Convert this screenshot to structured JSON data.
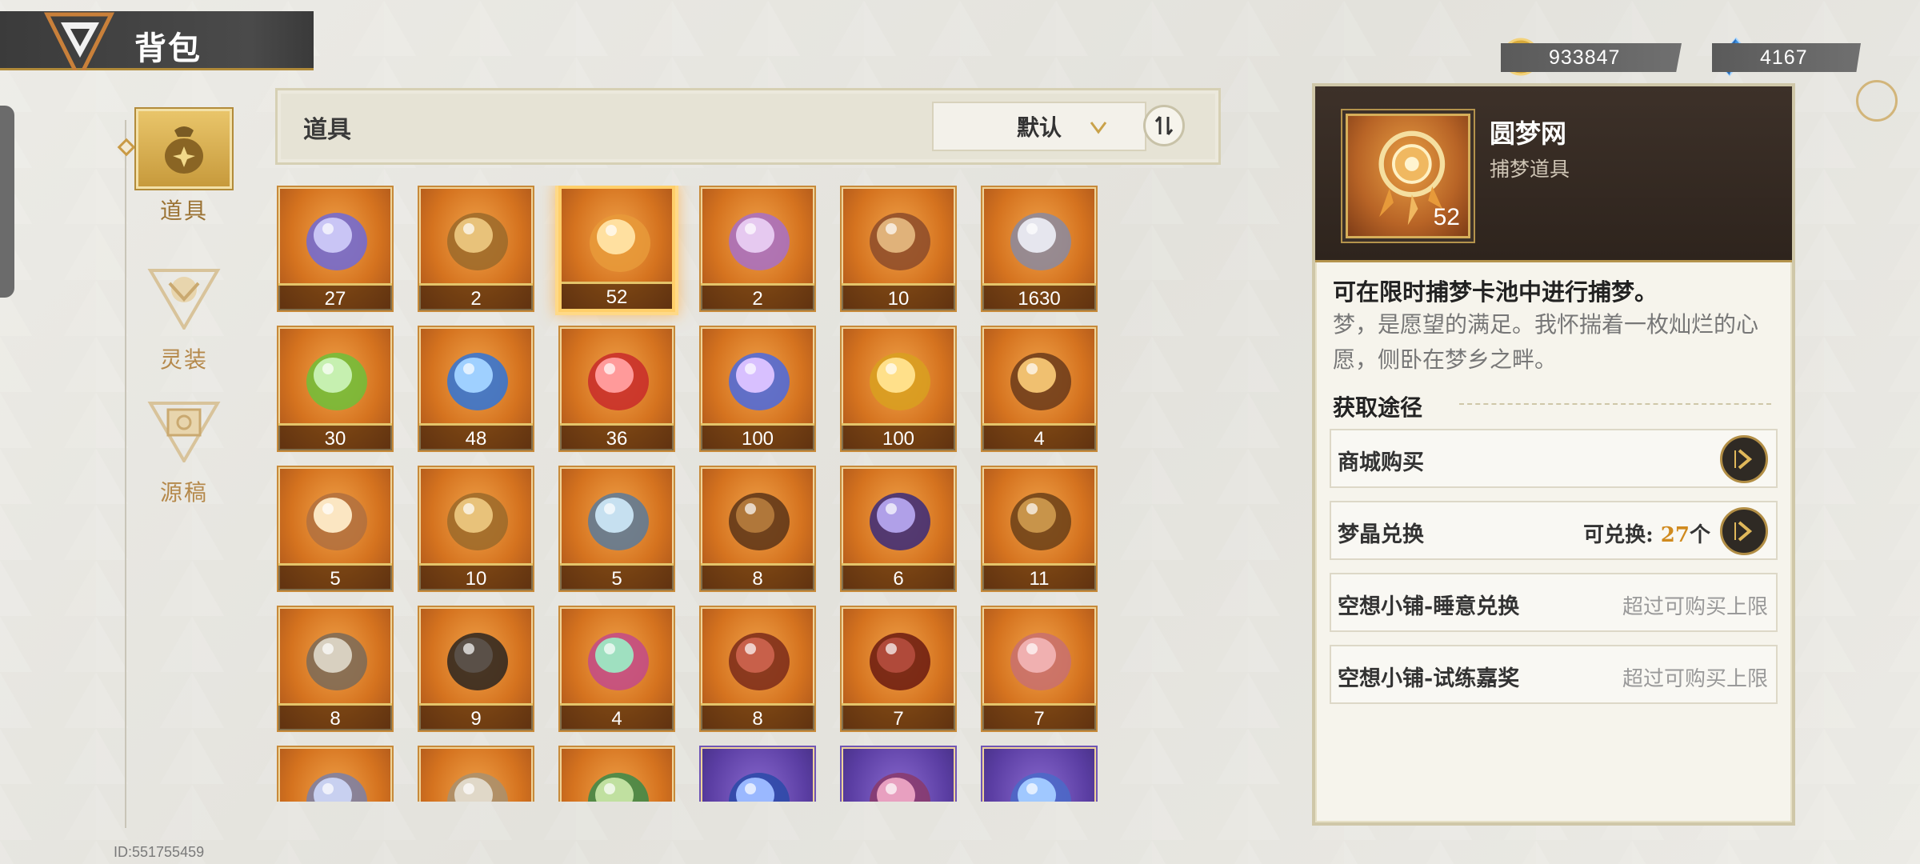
{
  "header": {
    "title": "背包",
    "logo_icon": "backpack-emblem-icon"
  },
  "currency": {
    "gold": {
      "icon": "gold-coin-icon",
      "value": "933847"
    },
    "crystal": {
      "icon": "blue-crystal-icon",
      "value": "4167"
    }
  },
  "nav": {
    "items": [
      {
        "label": "道具",
        "icon": "bag-icon",
        "active": true
      },
      {
        "label": "灵装",
        "icon": "equipment-icon",
        "active": false
      },
      {
        "label": "源稿",
        "icon": "manuscript-icon",
        "active": false
      }
    ]
  },
  "user": {
    "id_text": "ID:551755459"
  },
  "category": {
    "title": "道具",
    "sort_label": "默认",
    "sort_order_icon": "sort-order-icon"
  },
  "items": [
    {
      "count": "27",
      "art": "dreamcatcher-blue"
    },
    {
      "count": "2",
      "art": "golden-creature"
    },
    {
      "count": "52",
      "art": "dreamcatcher-orange",
      "selected": true
    },
    {
      "count": "2",
      "art": "mask-tickets"
    },
    {
      "count": "10",
      "art": "treasure-chest"
    },
    {
      "count": "1630",
      "art": "spinning-top"
    },
    {
      "count": "30",
      "art": "feather-quill"
    },
    {
      "count": "48",
      "art": "blue-star-crystal"
    },
    {
      "count": "36",
      "art": "red-star-crystal"
    },
    {
      "count": "100",
      "art": "rainbow-star-crystal"
    },
    {
      "count": "100",
      "art": "gold-star-crystal"
    },
    {
      "count": "4",
      "art": "ornate-frame"
    },
    {
      "count": "5",
      "art": "pop-up-book"
    },
    {
      "count": "10",
      "art": "gold-trophy-figure"
    },
    {
      "count": "5",
      "art": "anchor-statue"
    },
    {
      "count": "8",
      "art": "melted-candle-tree"
    },
    {
      "count": "6",
      "art": "galaxy-orb-candle"
    },
    {
      "count": "11",
      "art": "spiral-candle"
    },
    {
      "count": "8",
      "art": "melted-shield"
    },
    {
      "count": "9",
      "art": "melted-cone"
    },
    {
      "count": "4",
      "art": "harlequin-crown"
    },
    {
      "count": "8",
      "art": "melted-sword"
    },
    {
      "count": "7",
      "art": "candle-number-6"
    },
    {
      "count": "7",
      "art": "pink-ghost-candle"
    },
    {
      "count": "",
      "art": "partial-item-1"
    },
    {
      "count": "",
      "art": "partial-item-2"
    },
    {
      "count": "",
      "art": "partial-item-3"
    },
    {
      "count": "",
      "art": "partial-item-4",
      "rarity": "purple"
    },
    {
      "count": "",
      "art": "partial-item-5",
      "rarity": "purple"
    },
    {
      "count": "",
      "art": "partial-item-6",
      "rarity": "purple"
    }
  ],
  "detail": {
    "name": "圆梦网",
    "type": "捕梦道具",
    "count": "52",
    "desc_main": "可在限时捕梦卡池中进行捕梦。",
    "desc_sub": "梦，是愿望的满足。我怀揣着一枚灿烂的心愿，侧卧在梦乡之畔。",
    "acquire_title": "获取途径",
    "acquire": [
      {
        "label": "商城购买",
        "right": "",
        "has_go": true
      },
      {
        "label": "梦晶兑换",
        "exchange_prefix": "可兑换: ",
        "exchange_num": "27",
        "exchange_suffix": "个",
        "has_go": true
      },
      {
        "label": "空想小铺-睡意兑换",
        "right": "超过可购买上限",
        "has_go": false
      },
      {
        "label": "空想小铺-试练嘉奖",
        "right": "超过可购买上限",
        "has_go": false
      }
    ]
  },
  "colors": {
    "accent_gold": "#c99a45",
    "cell_orange": "#d5731f",
    "cell_purple": "#5b3ea3",
    "exchange_num": "#d08a1e"
  }
}
